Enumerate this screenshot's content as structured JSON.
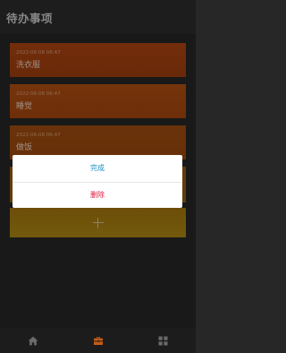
{
  "header": {
    "title": "待办事项"
  },
  "todos": [
    {
      "time": "2022-06-08 06:47",
      "text": "洗衣服"
    },
    {
      "time": "2022-06-08 06:47",
      "text": "睡觉"
    },
    {
      "time": "2022-06-08 06:47",
      "text": "做饭"
    },
    {
      "time": "",
      "text": ""
    }
  ],
  "add_button": {
    "icon": "plus-icon"
  },
  "dialog": {
    "done_label": "完成",
    "delete_label": "删除"
  },
  "tabbar": {
    "items": [
      {
        "icon": "home-icon",
        "active": false
      },
      {
        "icon": "briefcase-icon",
        "active": true
      },
      {
        "icon": "grid-icon",
        "active": false
      }
    ]
  },
  "colors": {
    "accent_active": "#c55a14",
    "done": "#1f8ec5",
    "delete": "#e0173b"
  }
}
